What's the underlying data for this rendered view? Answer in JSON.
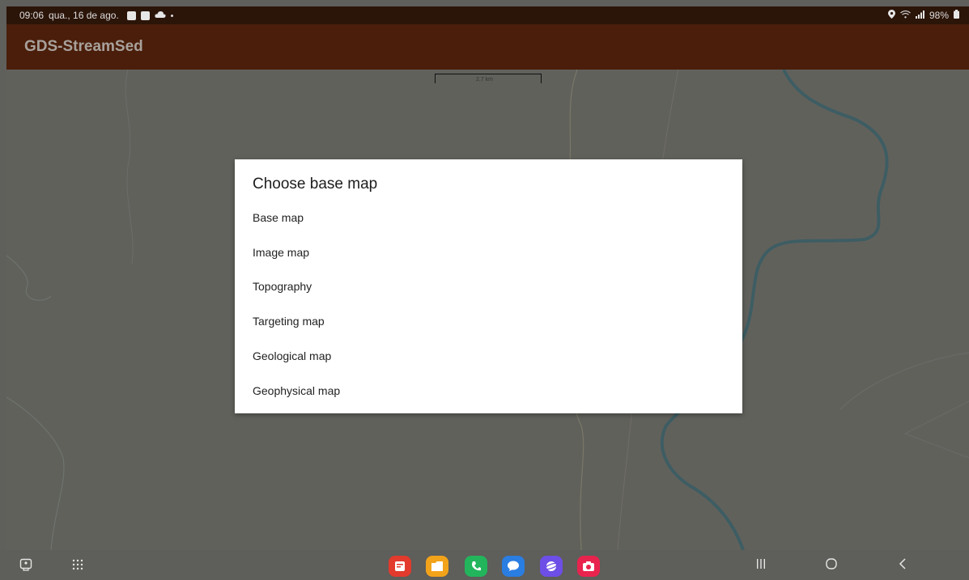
{
  "status_bar": {
    "time": "09:06",
    "date": "qua., 16 de ago.",
    "notification_icons": [
      "photo-icon",
      "image-icon",
      "cloud-icon",
      "dot-icon"
    ],
    "right_icons": [
      "location-icon",
      "wifi-icon",
      "signal-icon"
    ],
    "battery": "98%"
  },
  "app_bar": {
    "title": "GDS-StreamSed"
  },
  "map": {
    "scale_label": "2,7 km"
  },
  "dialog": {
    "title": "Choose base map",
    "options": [
      {
        "label": "Base map"
      },
      {
        "label": "Image map"
      },
      {
        "label": "Topography"
      },
      {
        "label": "Targeting map"
      },
      {
        "label": "Geological map"
      },
      {
        "label": "Geophysical map"
      }
    ]
  },
  "navigation_bar": {
    "left_buttons": [
      "screen-capture-icon",
      "app-grid-icon"
    ],
    "dock_apps": [
      {
        "name": "notes-app",
        "color": "#e23a2c"
      },
      {
        "name": "files-app",
        "color": "#f2a31a"
      },
      {
        "name": "phone-app",
        "color": "#22b55c"
      },
      {
        "name": "messages-app",
        "color": "#2a7de1"
      },
      {
        "name": "internet-app",
        "color": "#6d4ee6"
      },
      {
        "name": "camera-app",
        "color": "#e8234d"
      }
    ],
    "system_buttons": [
      "recents-icon",
      "home-icon",
      "back-icon"
    ]
  }
}
